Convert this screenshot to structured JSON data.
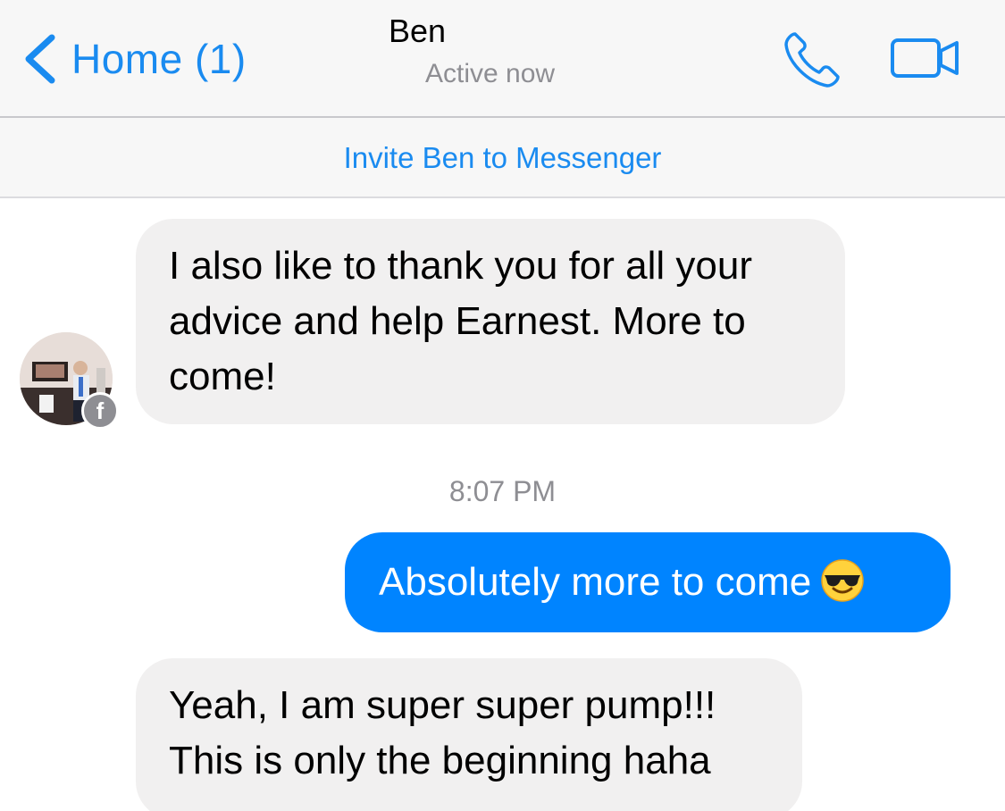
{
  "header": {
    "back_label": "Home (1)",
    "contact_name": "Ben",
    "status": "Active now",
    "icons": [
      "chevron-left-icon",
      "phone-icon",
      "video-camera-icon"
    ]
  },
  "invite": {
    "label": "Invite Ben to Messenger"
  },
  "messages": [
    {
      "direction": "incoming",
      "text": "I also like to thank you for all your advice and help Earnest. More to come!"
    },
    {
      "direction": "outgoing",
      "text": "Absolutely more to come",
      "emoji": "sunglasses-emoji"
    },
    {
      "direction": "incoming",
      "text": "Yeah, I am super super pump!!! This is only the beginning haha"
    }
  ],
  "timestamp": "8:07 PM",
  "avatar": {
    "badge": "f"
  },
  "colors": {
    "accent": "#1a8bf0",
    "outgoing_bubble": "#0084ff",
    "incoming_bubble": "#f1f0f0",
    "secondary_text": "#8e8e93"
  }
}
